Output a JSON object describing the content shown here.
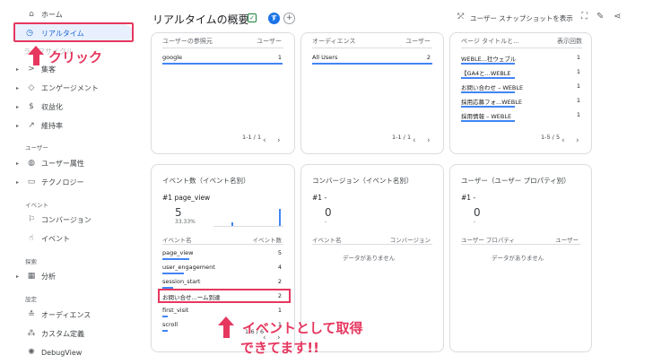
{
  "sidebar": {
    "items": [
      {
        "label": "ホーム",
        "icon": "home-icon"
      },
      {
        "label": "リアルタイム",
        "icon": "clock-icon"
      },
      {
        "label": "ライフサイクル",
        "icon": "none"
      },
      {
        "label": "集客",
        "icon": "acquisition-icon"
      },
      {
        "label": "エンゲージメント",
        "icon": "tag-icon"
      },
      {
        "label": "収益化",
        "icon": "dollar-icon"
      },
      {
        "label": "維持率",
        "icon": "retention-icon"
      },
      {
        "label": "ユーザー属性",
        "icon": "globe-icon"
      },
      {
        "label": "テクノロジー",
        "icon": "devices-icon"
      },
      {
        "label": "コンバージョン",
        "icon": "flag-icon"
      },
      {
        "label": "イベント",
        "icon": "touch-icon"
      },
      {
        "label": "分析",
        "icon": "analysis-icon"
      },
      {
        "label": "オーディエンス",
        "icon": "audience-icon"
      },
      {
        "label": "カスタム定義",
        "icon": "custom-icon"
      },
      {
        "label": "DebugView",
        "icon": "debug-icon"
      }
    ],
    "sections": {
      "user": "ユーザー",
      "event": "イベント",
      "explore": "探索",
      "config": "設定"
    }
  },
  "header": {
    "title": "リアルタイムの概要",
    "avatar": "す",
    "snapshot": "ユーザー スナップショットを表示"
  },
  "cards": {
    "referral": {
      "col1": "ユーザーの参照元",
      "col2": "ユーザー",
      "rows": [
        {
          "name": "google",
          "value": "1"
        }
      ],
      "pager": "1-1 / 1"
    },
    "audience": {
      "col1": "オーディエンス",
      "col2": "ユーザー",
      "rows": [
        {
          "name": "All Users",
          "value": "2"
        }
      ],
      "pager": "1-1 / 1"
    },
    "pages": {
      "col1": "ページ タイトルと...",
      "col2": "表示回数",
      "rows": [
        {
          "name": "WEBLE...社ウェブル",
          "value": "1"
        },
        {
          "name": "【GA4と...WEBLE",
          "value": "1"
        },
        {
          "name": "お問い合わせ – WEBLE",
          "value": "1"
        },
        {
          "name": "採用応募フォ...WEBLE",
          "value": "1"
        },
        {
          "name": "採用情報 – WEBLE",
          "value": "1"
        }
      ],
      "pager": "1-5 / 5"
    },
    "events": {
      "title": "イベント数（イベント名別）",
      "top": "#1 page_view",
      "big": "5",
      "pct": "33.33%",
      "col1": "イベント名",
      "col2": "イベント数",
      "rows": [
        {
          "name": "page_view",
          "value": "5"
        },
        {
          "name": "user_engagement",
          "value": "4"
        },
        {
          "name": "session_start",
          "value": "2"
        },
        {
          "name": "お問い合せ...ーム到達",
          "value": "2"
        },
        {
          "name": "first_visit",
          "value": "1"
        },
        {
          "name": "scroll",
          "value": "1"
        }
      ],
      "pager": "1-6 / 6"
    },
    "conversions": {
      "title": "コンバージョン（イベント名別）",
      "top": "#1 -",
      "big": "0",
      "dash": "-",
      "col1": "イベント名",
      "col2": "コンバージョン",
      "empty": "データがありません"
    },
    "userprops": {
      "title": "ユーザー（ユーザー プロパティ別）",
      "top": "#1 -",
      "big": "0",
      "dash": "-",
      "col1": "ユーザー プロパティ",
      "col2": "ユーザー",
      "empty": "データがありません"
    }
  },
  "annotations": {
    "click": "クリック",
    "event_line1": "イベントとして取得",
    "event_line2": "できてます!!"
  },
  "colors": {
    "accent": "#e6375f",
    "blue": "#1a73e8"
  }
}
